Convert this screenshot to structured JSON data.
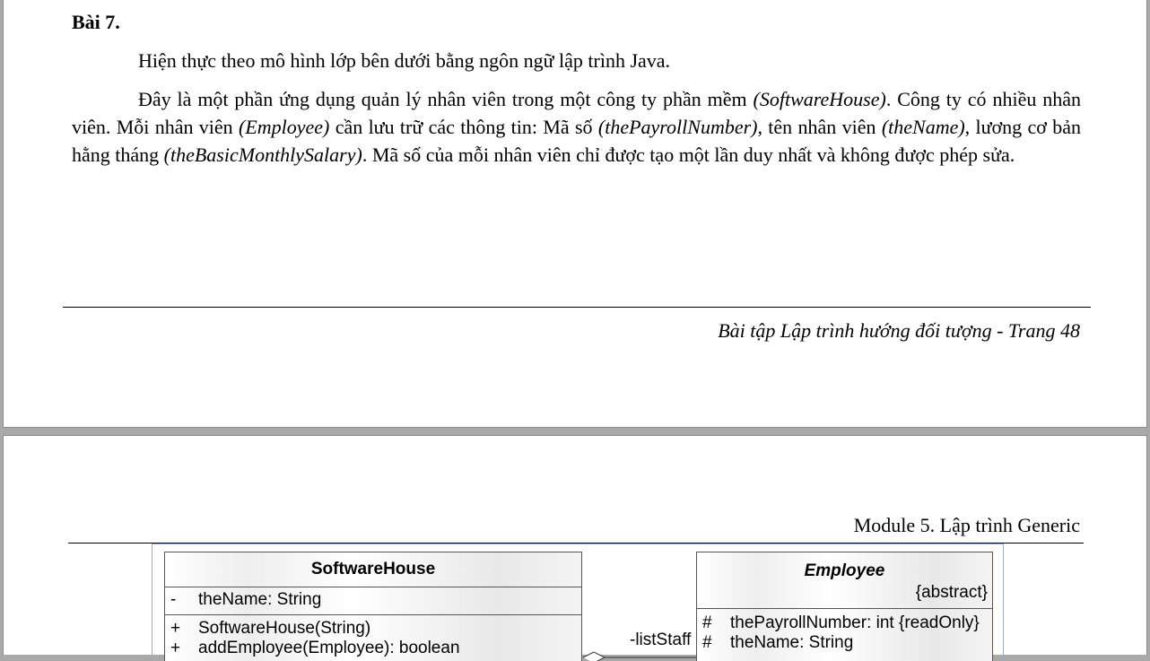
{
  "page1": {
    "heading": "Bài 7.",
    "para1": "Hiện thực theo mô hình lớp bên dưới bằng ngôn ngữ lập trình Java.",
    "para2": {
      "t1": "Đây là một phần ứng dụng quản lý nhân viên trong một công ty phần mềm ",
      "i1": "(SoftwareHouse)",
      "t2": ". Công ty có nhiều nhân viên. Mỗi nhân viên ",
      "i2": "(Employee)",
      "t3": " cần lưu trữ các thông tin: Mã số ",
      "i3": "(thePayrollNumber)",
      "t4": ", tên nhân viên ",
      "i4": "(theName)",
      "t5": ", lương cơ bản hằng tháng ",
      "i5": "(theBasicMonthlySalary)",
      "t6": ". Mã số của mỗi nhân viên chỉ được tạo một lần duy nhất và không được phép sửa."
    },
    "footer": "Bài tập Lập trình hướng đối tượng - Trang 48"
  },
  "page2": {
    "header": "Module 5. Lập trình Generic"
  },
  "diagram": {
    "software_house": {
      "name": "SoftwareHouse",
      "attributes": [
        {
          "vis": "-",
          "text": "theName: String"
        }
      ],
      "operations": [
        {
          "vis": "+",
          "text": "SoftwareHouse(String)"
        },
        {
          "vis": "+",
          "text": "addEmployee(Employee): boolean"
        }
      ]
    },
    "employee": {
      "name": "Employee",
      "stereotype": "{abstract}",
      "attributes": [
        {
          "vis": "#",
          "text": "thePayrollNumber: int {readOnly}"
        },
        {
          "vis": "#",
          "text": "theName: String"
        }
      ]
    },
    "association_role": "-listStaff"
  }
}
